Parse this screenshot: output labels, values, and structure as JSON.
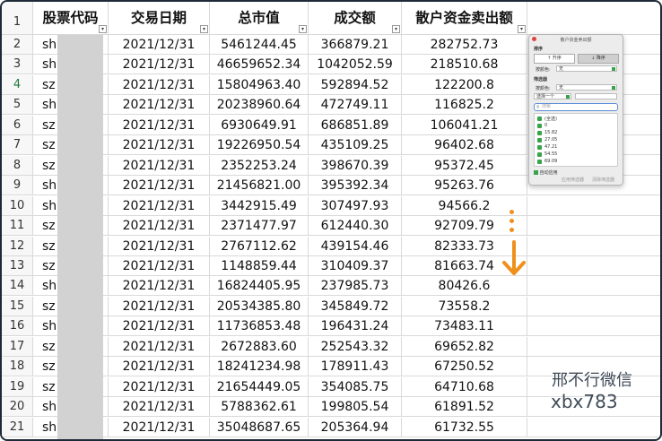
{
  "headers": [
    "股票代码",
    "交易日期",
    "总市值",
    "成交额",
    "散户资金卖出额"
  ],
  "header_row_number": "1",
  "rows": [
    {
      "n": "2",
      "code": "sh",
      "date": "2021/12/31",
      "mv": "5461244.45",
      "amt": "366879.21",
      "sell": "282752.73"
    },
    {
      "n": "3",
      "code": "sh",
      "date": "2021/12/31",
      "mv": "46659652.34",
      "amt": "1042052.59",
      "sell": "218510.68"
    },
    {
      "n": "4",
      "code": "sz",
      "date": "2021/12/31",
      "mv": "15804963.40",
      "amt": "592894.52",
      "sell": "122200.8"
    },
    {
      "n": "5",
      "code": "sh",
      "date": "2021/12/31",
      "mv": "20238960.64",
      "amt": "472749.11",
      "sell": "116825.2"
    },
    {
      "n": "6",
      "code": "sz",
      "date": "2021/12/31",
      "mv": "6930649.91",
      "amt": "686851.89",
      "sell": "106041.21"
    },
    {
      "n": "7",
      "code": "sz",
      "date": "2021/12/31",
      "mv": "19226950.54",
      "amt": "435109.25",
      "sell": "96402.68"
    },
    {
      "n": "8",
      "code": "sz",
      "date": "2021/12/31",
      "mv": "2352253.24",
      "amt": "398670.39",
      "sell": "95372.45"
    },
    {
      "n": "9",
      "code": "sh",
      "date": "2021/12/31",
      "mv": "21456821.00",
      "amt": "395392.34",
      "sell": "95263.76"
    },
    {
      "n": "10",
      "code": "sh",
      "date": "2021/12/31",
      "mv": "3442915.49",
      "amt": "307497.93",
      "sell": "94566.2"
    },
    {
      "n": "11",
      "code": "sz",
      "date": "2021/12/31",
      "mv": "2371477.97",
      "amt": "612440.30",
      "sell": "92709.79"
    },
    {
      "n": "12",
      "code": "sz",
      "date": "2021/12/31",
      "mv": "2767112.62",
      "amt": "439154.46",
      "sell": "82333.73"
    },
    {
      "n": "13",
      "code": "sz",
      "date": "2021/12/31",
      "mv": "1148859.44",
      "amt": "310409.37",
      "sell": "81663.74"
    },
    {
      "n": "14",
      "code": "sh",
      "date": "2021/12/31",
      "mv": "16824405.95",
      "amt": "237985.73",
      "sell": "80426.6"
    },
    {
      "n": "15",
      "code": "sz",
      "date": "2021/12/31",
      "mv": "20534385.80",
      "amt": "345849.72",
      "sell": "73558.2"
    },
    {
      "n": "16",
      "code": "sh",
      "date": "2021/12/31",
      "mv": "11736853.48",
      "amt": "196431.24",
      "sell": "73483.11"
    },
    {
      "n": "17",
      "code": "sz",
      "date": "2021/12/31",
      "mv": "2672883.60",
      "amt": "252543.32",
      "sell": "69652.82"
    },
    {
      "n": "18",
      "code": "sz",
      "date": "2021/12/31",
      "mv": "18241234.98",
      "amt": "178911.43",
      "sell": "67250.52"
    },
    {
      "n": "19",
      "code": "sz",
      "date": "2021/12/31",
      "mv": "21654449.05",
      "amt": "354085.75",
      "sell": "64710.68"
    },
    {
      "n": "20",
      "code": "sh",
      "date": "2021/12/31",
      "mv": "5788362.61",
      "amt": "199805.54",
      "sell": "61891.52"
    },
    {
      "n": "21",
      "code": "sh",
      "date": "2021/12/31",
      "mv": "35048687.65",
      "amt": "205364.94",
      "sell": "61732.55"
    }
  ],
  "active_row": "4",
  "filter_popup": {
    "title": "散户资金卖出额",
    "sort_section": "排序",
    "sort_asc": "升序",
    "sort_desc": "降序",
    "sort_color_label": "按颜色:",
    "sort_color_value": "无",
    "filter_section": "筛选器",
    "filter_color_label": "按颜色:",
    "filter_color_value": "无",
    "condition_value": "选择一个",
    "search_placeholder": "搜索",
    "list_items": [
      "(全选)",
      "0",
      "15.82",
      "27.05",
      "47.21",
      "54.55",
      "69.09"
    ],
    "auto_apply": "自动应用",
    "apply_button": "应用筛选器",
    "clear_button": "清除筛选器"
  },
  "watermark": {
    "line1": "邢不行微信",
    "line2": "xbx783"
  },
  "colors": {
    "accent": "#37a34a",
    "arrow": "#f0901c",
    "redacted": "#d2d2d2"
  }
}
